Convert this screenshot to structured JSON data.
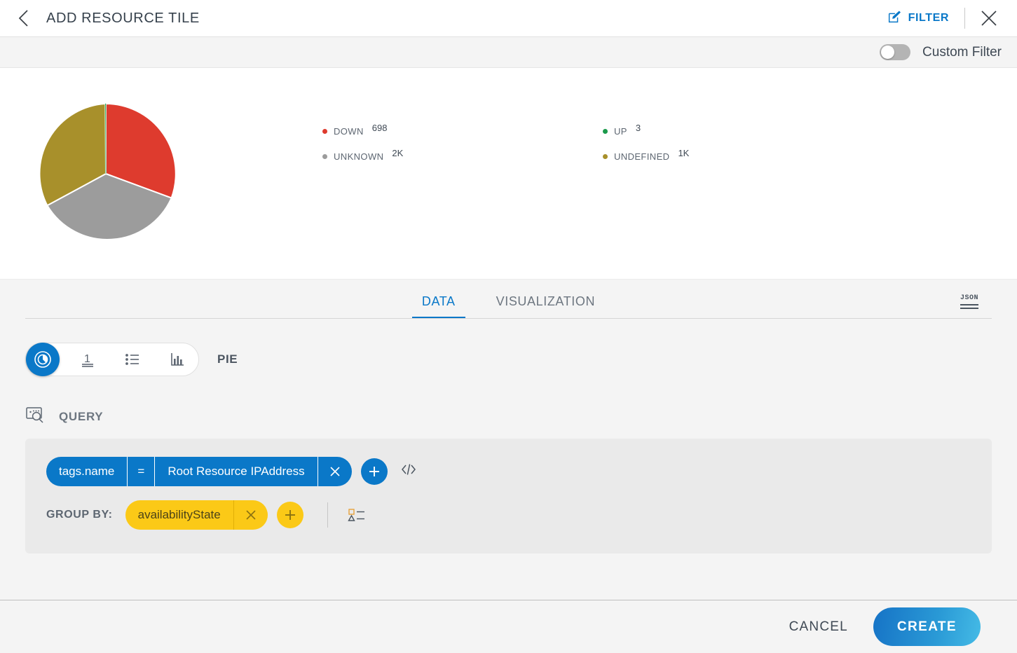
{
  "header": {
    "title": "ADD RESOURCE TILE",
    "back_icon": "chevron-left-icon",
    "filter_label": "FILTER",
    "filter_icon": "edit-pencil-icon",
    "close_icon": "close-icon"
  },
  "custom_filter": {
    "label": "Custom Filter",
    "enabled": false
  },
  "chart_data": {
    "type": "pie",
    "title": "",
    "categories": [
      "DOWN",
      "UNKNOWN",
      "UP",
      "UNDEFINED"
    ],
    "values": [
      698,
      2000,
      3,
      1000
    ],
    "display_values": [
      "698",
      "2K",
      "3",
      "1K"
    ],
    "colors": [
      "#de3b2e",
      "#9c9c9c",
      "#1b9a4b",
      "#a8902b"
    ],
    "legend_position": "right",
    "legend": [
      {
        "label": "DOWN",
        "value": "698",
        "color": "#de3b2e"
      },
      {
        "label": "UP",
        "value": "3",
        "color": "#1b9a4b"
      },
      {
        "label": "UNKNOWN",
        "value": "2K",
        "color": "#9c9c9c"
      },
      {
        "label": "UNDEFINED",
        "value": "1K",
        "color": "#a8902b"
      }
    ],
    "slices": [
      {
        "label": "DOWN",
        "percent": 18.9,
        "color": "#de3b2e"
      },
      {
        "label": "UNKNOWN",
        "percent": 45.2,
        "color": "#9c9c9c"
      },
      {
        "label": "UNDEFINED",
        "percent": 35.8,
        "color": "#a8902b"
      },
      {
        "label": "UP",
        "percent": 0.1,
        "color": "#1b9a4b"
      }
    ]
  },
  "tabs": [
    {
      "label": "DATA",
      "active": true
    },
    {
      "label": "VISUALIZATION",
      "active": false
    }
  ],
  "json_toggle": {
    "label": "JSON",
    "icon": "json-icon"
  },
  "chart_type_selector": {
    "name": "PIE",
    "options": [
      {
        "icon": "pie-chart-icon",
        "selected": true
      },
      {
        "icon": "single-value-icon",
        "selected": false
      },
      {
        "icon": "list-icon",
        "selected": false
      },
      {
        "icon": "bar-chart-icon",
        "selected": false
      }
    ]
  },
  "query": {
    "section_label": "QUERY",
    "section_icon": "query-search-icon",
    "filter": {
      "field": "tags.name",
      "operator": "=",
      "value": "Root Resource IPAddress",
      "remove_icon": "close-icon",
      "add_icon": "plus-icon",
      "code_icon": "code-brackets-icon"
    },
    "group_by": {
      "label": "GROUP BY:",
      "field": "availabilityState",
      "remove_icon": "close-icon",
      "add_icon": "plus-icon",
      "legend_config_icon": "legend-shapes-icon"
    }
  },
  "footer": {
    "cancel_label": "CANCEL",
    "create_label": "CREATE"
  },
  "colors": {
    "accent": "#0a78c8",
    "yellow": "#fbc917",
    "page_bg": "#f4f4f4"
  }
}
